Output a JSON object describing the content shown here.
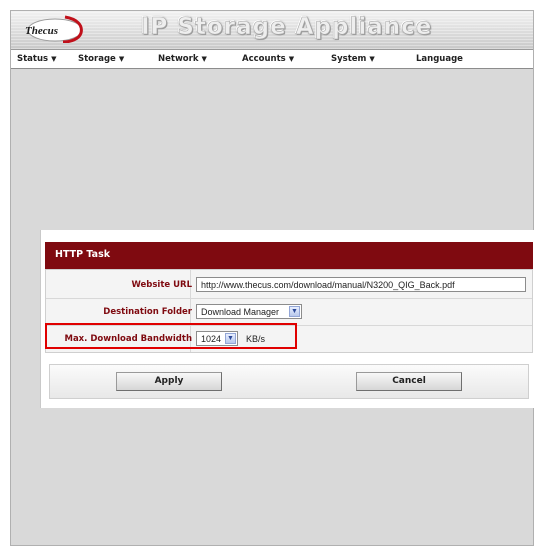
{
  "header": {
    "logo_text": "Thecus",
    "app_title": "IP Storage Appliance"
  },
  "nav": {
    "items": [
      {
        "label": "Status",
        "has_caret": true
      },
      {
        "label": "Storage",
        "has_caret": true
      },
      {
        "label": "Network",
        "has_caret": true
      },
      {
        "label": "Accounts",
        "has_caret": true
      },
      {
        "label": "System",
        "has_caret": true
      },
      {
        "label": "Language",
        "has_caret": false
      }
    ],
    "caret_glyph": "▼"
  },
  "panel": {
    "title": "HTTP Task",
    "fields": {
      "website_url": {
        "label": "Website URL",
        "value": "http://www.thecus.com/download/manual/N3200_QIG_Back.pdf"
      },
      "destination_folder": {
        "label": "Destination Folder",
        "selected": "Download Manager"
      },
      "max_bandwidth": {
        "label": "Max. Download Bandwidth",
        "selected": "1024",
        "unit": "KB/s"
      }
    },
    "buttons": {
      "apply": "Apply",
      "cancel": "Cancel"
    }
  },
  "colors": {
    "panel_header": "#7f0a10",
    "label_text": "#7f0a10",
    "highlight": "#e00000",
    "background": "#d9d9d9"
  },
  "icons": {
    "select_arrow": "chevron-down-icon",
    "logo": "thecus-logo-icon"
  }
}
